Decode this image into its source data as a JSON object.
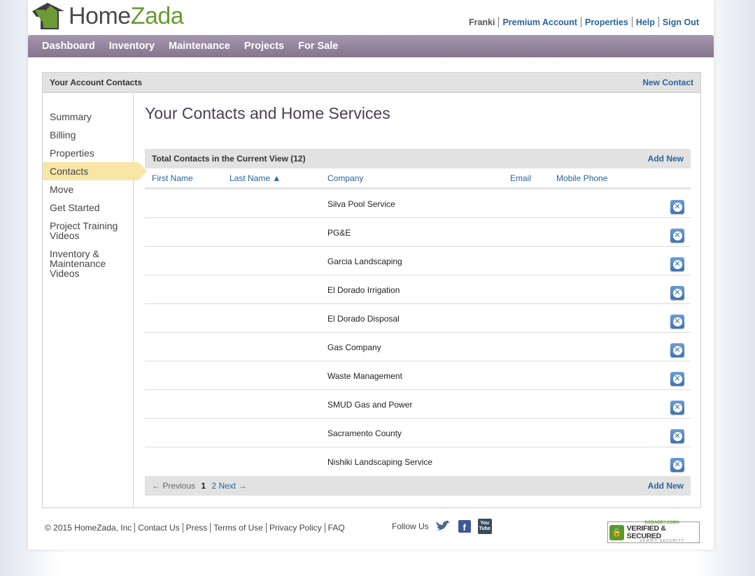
{
  "header": {
    "logo_home": "Home",
    "logo_zada": "Zada",
    "user": "Franki",
    "links": [
      "Premium Account",
      "Properties",
      "Help",
      "Sign Out"
    ]
  },
  "nav": [
    "Dashboard",
    "Inventory",
    "Maintenance",
    "Projects",
    "For Sale"
  ],
  "panel": {
    "title": "Your Account Contacts",
    "new_contact": "New Contact"
  },
  "sidebar": {
    "items": [
      "Summary",
      "Billing",
      "Properties",
      "Contacts",
      "Move",
      "Get Started",
      "Project Training Videos",
      "Inventory & Maintenance Videos"
    ],
    "active": "Contacts"
  },
  "main": {
    "page_title": "Your Contacts and Home Services",
    "total_label": "Total Contacts in the Current View (12)",
    "add_new": "Add New",
    "columns": [
      "First Name",
      "Last Name ▲",
      "Company",
      "Email",
      "Mobile Phone"
    ],
    "rows": [
      {
        "company": "Silva Pool Service"
      },
      {
        "company": "PG&E"
      },
      {
        "company": "Garcia Landscaping"
      },
      {
        "company": "El Dorado Irrigation"
      },
      {
        "company": "El Dorado Disposal"
      },
      {
        "company": "Gas Company"
      },
      {
        "company": "Waste Management"
      },
      {
        "company": "SMUD Gas and Power"
      },
      {
        "company": "Sacramento County"
      },
      {
        "company": "Nishiki Landscaping Service"
      }
    ]
  },
  "pager": {
    "prev": "← Previous",
    "current": "1",
    "page2": "2",
    "next": "Next →",
    "add_new": "Add New"
  },
  "footer": {
    "copyright": "© 2015 HomeZada, Inc",
    "links": [
      "Contact Us",
      "Press",
      "Terms of Use",
      "Privacy Policy",
      "FAQ"
    ],
    "follow_us": "Follow Us",
    "youtube_top": "You",
    "youtube_bottom": "Tube",
    "godaddy_top": "GODADDY.COM®",
    "godaddy_main": "VERIFIED & SECURED",
    "godaddy_bottom": "VERIFY SECURITY"
  },
  "colors": {
    "nav_bg": "#8f7f98",
    "brand_green": "#6a9b34",
    "link_blue": "#2a6496",
    "active_item": "#f7e6a6"
  }
}
